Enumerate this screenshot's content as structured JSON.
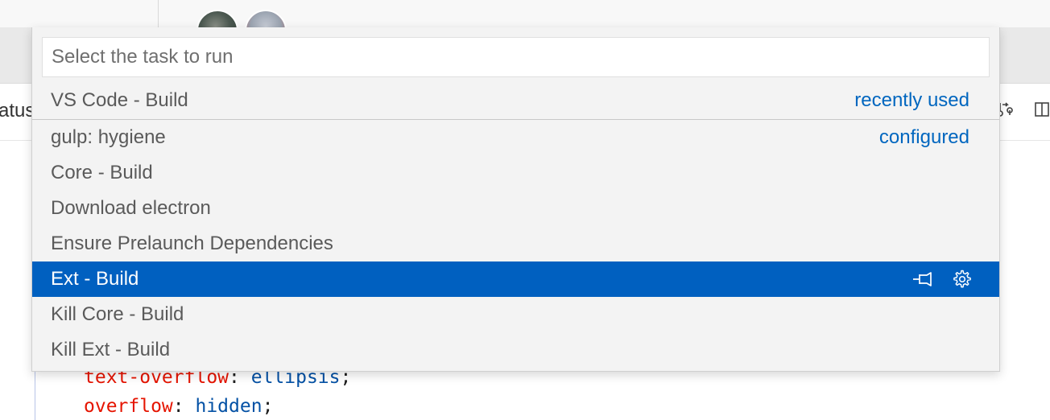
{
  "background": {
    "toolbar_label": "atus",
    "code_lines": [
      {
        "property": "text-overflow",
        "colon": ": ",
        "value": "ellipsis",
        "end": ";"
      },
      {
        "property": "overflow",
        "colon": ": ",
        "value": "hidden",
        "end": ";"
      }
    ],
    "toolbar_icons": [
      "source-control-sync-icon",
      "split-editor-icon"
    ]
  },
  "quick_pick": {
    "placeholder": "Select the task to run",
    "value": "",
    "items": [
      {
        "label": "VS Code - Build",
        "detail": "recently used"
      },
      {
        "label": "gulp: hygiene",
        "detail": "configured"
      },
      {
        "label": "Core - Build",
        "detail": ""
      },
      {
        "label": "Download electron",
        "detail": ""
      },
      {
        "label": "Ensure Prelaunch Dependencies",
        "detail": ""
      },
      {
        "label": "Ext - Build",
        "detail": "",
        "selected": true,
        "actions": [
          "pin-icon",
          "gear-icon"
        ]
      },
      {
        "label": "Kill Core - Build",
        "detail": ""
      },
      {
        "label": "Kill Ext - Build",
        "detail": ""
      }
    ]
  },
  "colors": {
    "selection": "#0060c0",
    "detail_link": "#0066bf",
    "code_property": "#e51400",
    "code_value": "#0451a5"
  }
}
